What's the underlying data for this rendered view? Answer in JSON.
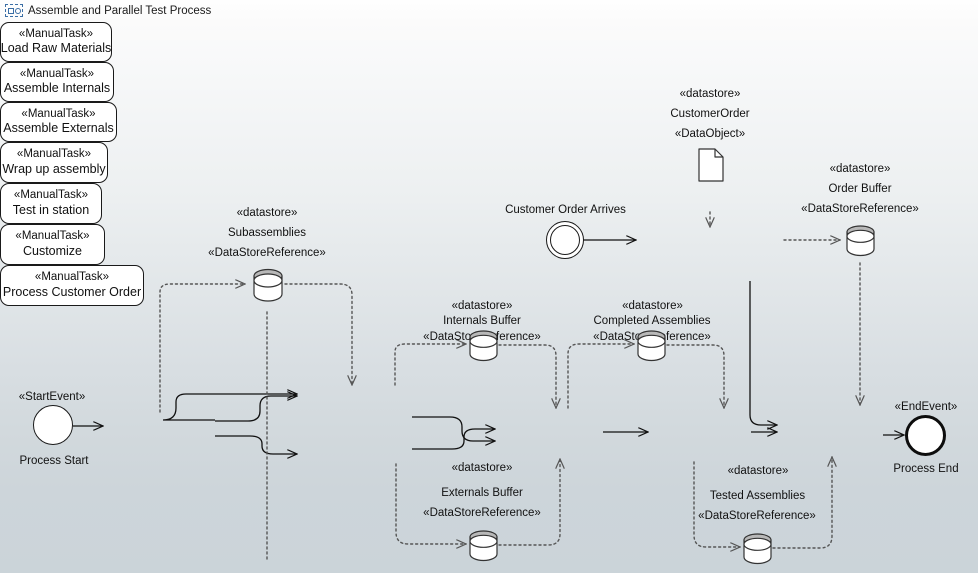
{
  "window": {
    "title": "Assemble and Parallel Test Process",
    "icon": "bpmn-process-icon"
  },
  "theme": {
    "background_top": "#fdfdfc",
    "background_bottom": "#cbd4d9",
    "node_fill": "#ffffff",
    "stroke": "#1a1a1a",
    "dashed_stroke": "#5a5a5a",
    "icon_accent": "#3b6ea5"
  },
  "stereotypes": {
    "manual_task": "«ManualTask»",
    "start_event": "«StartEvent»",
    "end_event": "«EndEvent»",
    "datastore": "«datastore»",
    "datastore_reference": "«DataStoreReference»",
    "data_object": "«DataObject»"
  },
  "tasks": [
    {
      "id": "load-raw-materials",
      "stereotype": "«ManualTask»",
      "name": "Load Raw Materials"
    },
    {
      "id": "assemble-internals",
      "stereotype": "«ManualTask»",
      "name": "Assemble Internals"
    },
    {
      "id": "assemble-externals",
      "stereotype": "«ManualTask»",
      "name": "Assemble Externals"
    },
    {
      "id": "wrap-up-assembly",
      "stereotype": "«ManualTask»",
      "name": "Wrap up assembly"
    },
    {
      "id": "test-in-station",
      "stereotype": "«ManualTask»",
      "name": "Test in station"
    },
    {
      "id": "customize",
      "stereotype": "«ManualTask»",
      "name": "Customize"
    },
    {
      "id": "process-customer-order",
      "stereotype": "«ManualTask»",
      "name": "Process Customer Order"
    }
  ],
  "events": [
    {
      "id": "process-start",
      "stereotype": "«StartEvent»",
      "name": "Process Start",
      "kind": "start"
    },
    {
      "id": "customer-order-arrives",
      "stereotype": "",
      "name": "Customer Order Arrives",
      "kind": "message-start"
    },
    {
      "id": "process-end",
      "stereotype": "«EndEvent»",
      "name": "Process End",
      "kind": "end"
    }
  ],
  "datastores": [
    {
      "id": "subassemblies",
      "stereotype": "«datastore»",
      "name": "Subassemblies",
      "reference": "«DataStoreReference»"
    },
    {
      "id": "internals-buffer",
      "stereotype": "«datastore»",
      "name": "Internals Buffer",
      "reference": "«DataStoreReference»"
    },
    {
      "id": "externals-buffer",
      "stereotype": "«datastore»",
      "name": "Externals Buffer",
      "reference": "«DataStoreReference»"
    },
    {
      "id": "completed-assemblies",
      "stereotype": "«datastore»",
      "name": "Completed Assemblies",
      "reference": "«DataStoreReference»"
    },
    {
      "id": "tested-assemblies",
      "stereotype": "«datastore»",
      "name": "Tested Assemblies",
      "reference": "«DataStoreReference»"
    },
    {
      "id": "order-buffer",
      "stereotype": "«datastore»",
      "name": "Order Buffer",
      "reference": "«DataStoreReference»"
    }
  ],
  "data_objects": [
    {
      "id": "customer-order",
      "stereotype": "«datastore»",
      "name": "CustomerOrder",
      "reference": "«DataObject»"
    }
  ]
}
